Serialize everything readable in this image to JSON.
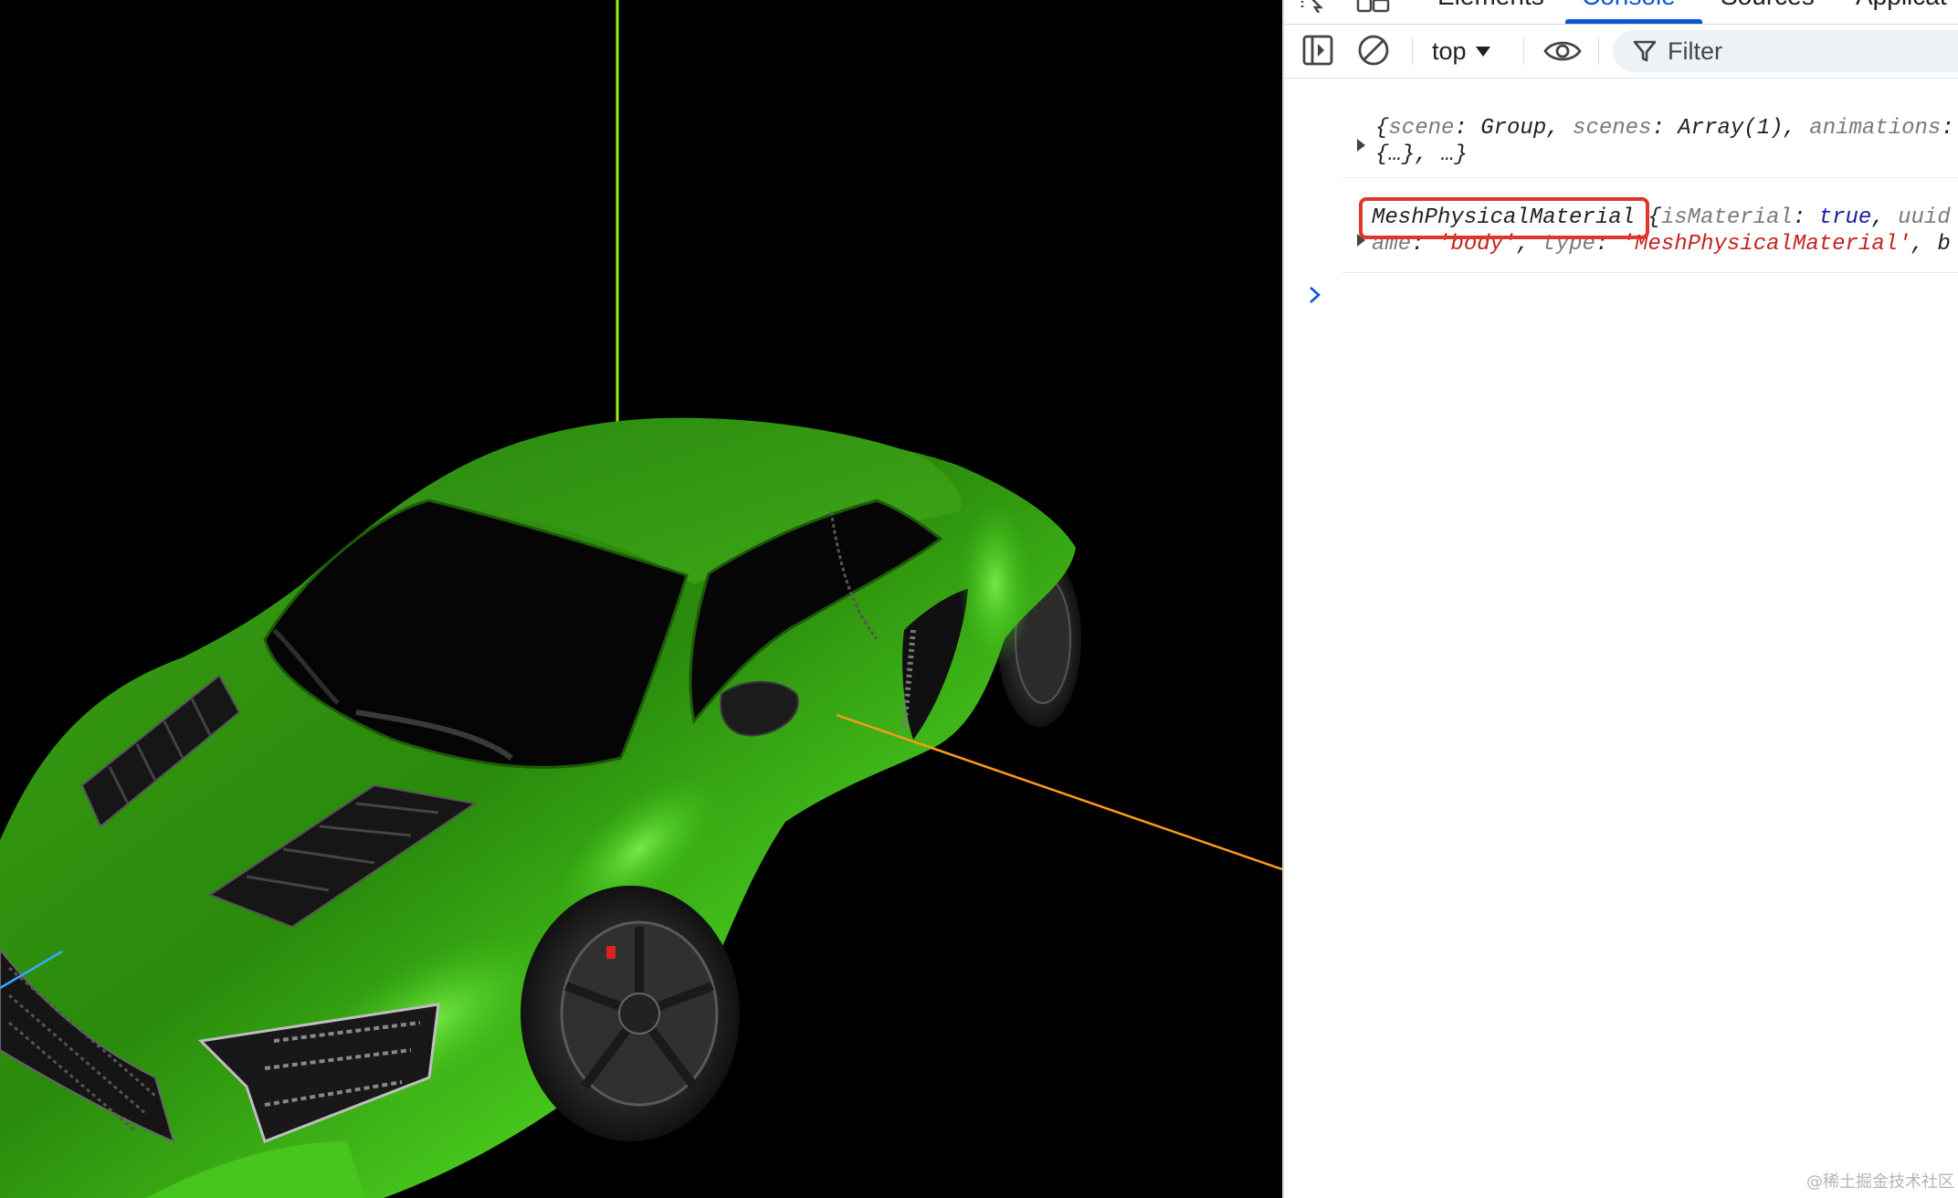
{
  "devtools": {
    "tabs": [
      {
        "label": "Elements",
        "active": false
      },
      {
        "label": "Console",
        "active": true
      },
      {
        "label": "Sources",
        "active": false
      },
      {
        "label": "Applicat",
        "active": false
      }
    ],
    "toolbar": {
      "context": "top",
      "filter_placeholder": "Filter"
    },
    "console": {
      "entry1": {
        "line1": [
          {
            "t": "{",
            "c": "p"
          },
          {
            "t": "scene",
            "c": "k"
          },
          {
            "t": ": Group, ",
            "c": "v"
          },
          {
            "t": "scenes",
            "c": "k"
          },
          {
            "t": ": Array(1), ",
            "c": "v"
          },
          {
            "t": "animations",
            "c": "k"
          },
          {
            "t": ":",
            "c": "v"
          }
        ],
        "line2": [
          {
            "t": "{…}, …}",
            "c": "p"
          }
        ]
      },
      "entry2": {
        "highlighted_class": "MeshPhysicalMaterial",
        "line1": [
          {
            "t": "MeshPhysicalMaterial ",
            "c": "v"
          },
          {
            "t": "{",
            "c": "p"
          },
          {
            "t": "isMaterial",
            "c": "k"
          },
          {
            "t": ": ",
            "c": "v"
          },
          {
            "t": "true",
            "c": "b"
          },
          {
            "t": ", ",
            "c": "v"
          },
          {
            "t": "uuid",
            "c": "k"
          }
        ],
        "line2": [
          {
            "t": "ame",
            "c": "k"
          },
          {
            "t": ": ",
            "c": "v"
          },
          {
            "t": "'body'",
            "c": "s"
          },
          {
            "t": ", ",
            "c": "v"
          },
          {
            "t": "type",
            "c": "k"
          },
          {
            "t": ": ",
            "c": "v"
          },
          {
            "t": "'MeshPhysicalMaterial'",
            "c": "s"
          },
          {
            "t": ", b",
            "c": "v"
          }
        ]
      },
      "prompt": "›"
    }
  },
  "viewport": {
    "model_color": "#2f9a12",
    "axis_colors": {
      "y": "#9cf020",
      "x": "#ff9a18",
      "z": "#3aa8ff"
    }
  },
  "watermark": "@稀土掘金技术社区"
}
